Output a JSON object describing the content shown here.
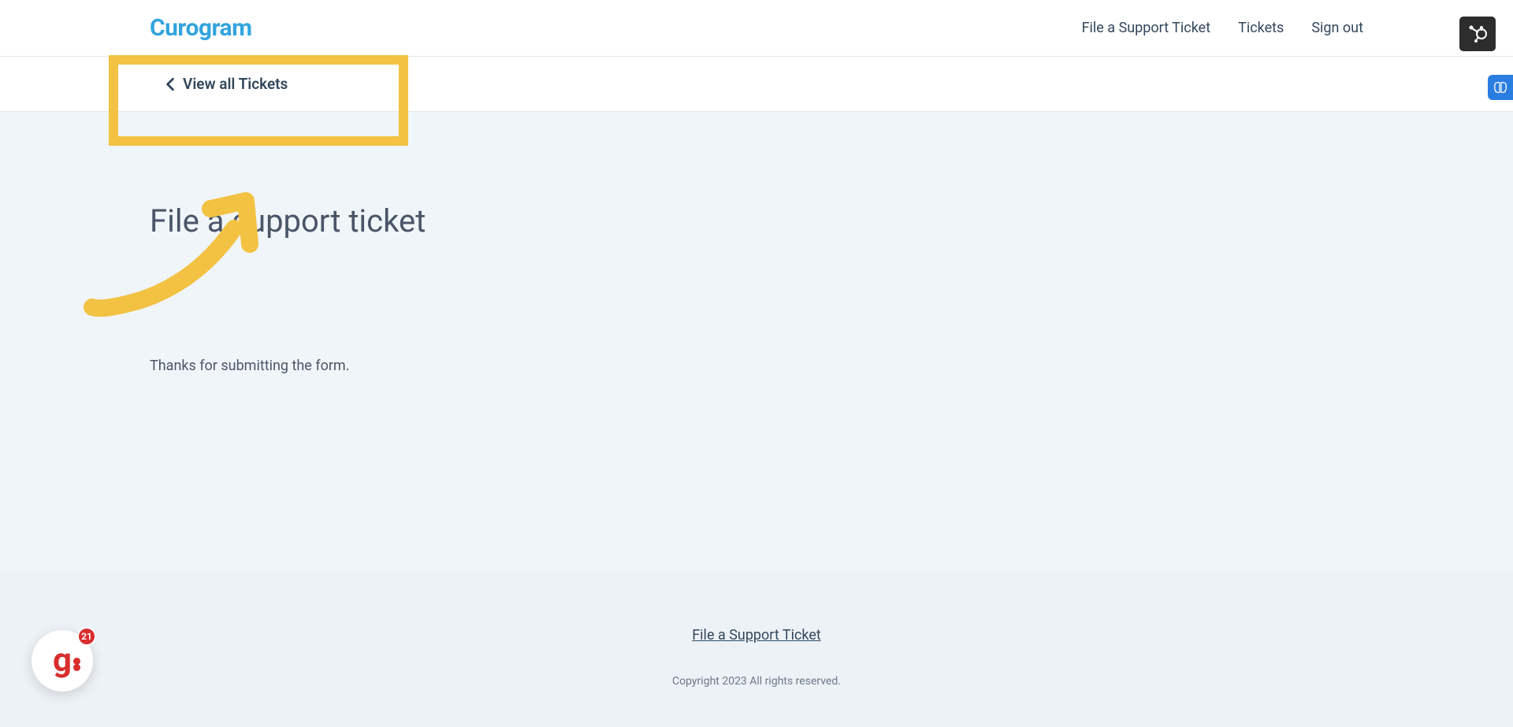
{
  "header": {
    "logo": "Curogram",
    "nav": {
      "file_ticket": "File a Support Ticket",
      "tickets": "Tickets",
      "sign_out": "Sign out"
    }
  },
  "subheader": {
    "view_all": "View all Tickets"
  },
  "main": {
    "title": "File a support ticket",
    "thanks_message": "Thanks for submitting the form."
  },
  "footer": {
    "link": "File a Support Ticket",
    "copyright": "Copyright 2023 All rights reserved."
  },
  "floating": {
    "notification_count": "21",
    "glyph": "g"
  },
  "colors": {
    "brand": "#33a4dd",
    "highlight": "#f3c243",
    "text": "#33475b",
    "danger": "#d92e2e"
  }
}
